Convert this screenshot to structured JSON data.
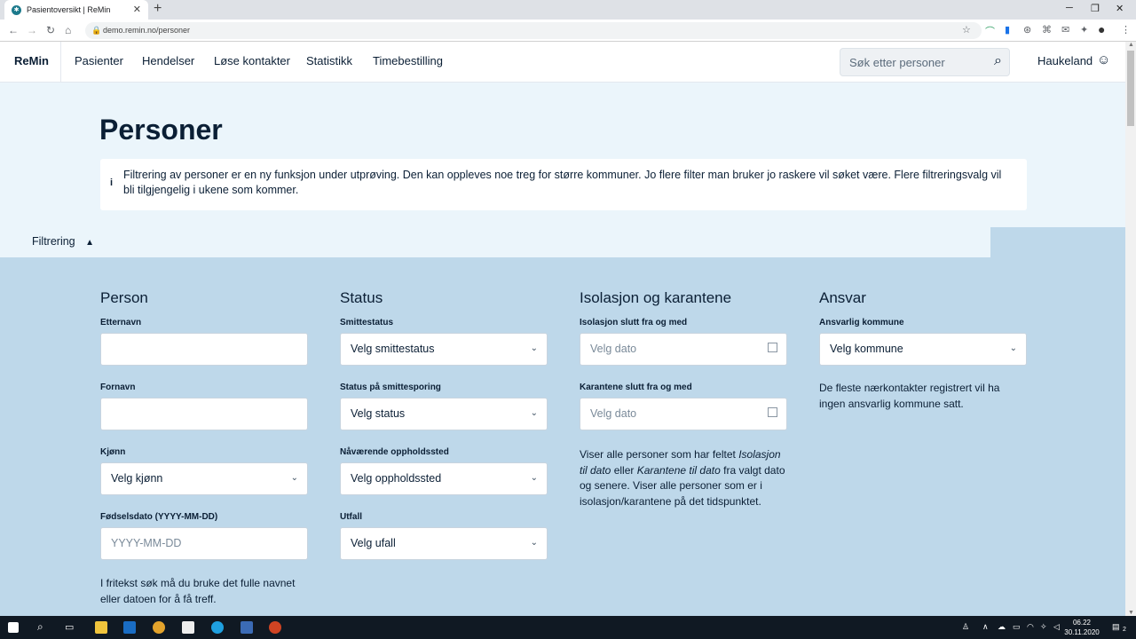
{
  "browser": {
    "tab_title": "Pasientoversikt | ReMin",
    "new_tab": "+",
    "url": "demo.remin.no/personer",
    "minimize": "─",
    "restore": "❐",
    "close": "✕"
  },
  "header": {
    "brand": "ReMin",
    "nav": [
      "Pasienter",
      "Hendelser",
      "Løse kontakter",
      "Statistikk",
      "Timebestilling"
    ],
    "search_placeholder": "Søk etter personer",
    "user": "Haukeland"
  },
  "page": {
    "title": "Personer",
    "info": "Filtrering av personer er en ny funksjon under utprøving. Den kan oppleves noe treg for større kommuner. Jo flere filter man bruker jo raskere vil søket være. Flere filtreringsvalg vil bli tilgjengelig i ukene som kommer.",
    "filter_toggle": "Filtrering"
  },
  "person": {
    "heading": "Person",
    "etternavn_label": "Etternavn",
    "fornavn_label": "Fornavn",
    "kjonn_label": "Kjønn",
    "kjonn_value": "Velg kjønn",
    "fodsel_label": "Fødselsdato (YYYY-MM-DD)",
    "fodsel_placeholder": "YYYY-MM-DD",
    "note": "I fritekst søk må du bruke det fulle navnet eller datoen for å få treff."
  },
  "status": {
    "heading": "Status",
    "smitte_label": "Smittestatus",
    "smitte_value": "Velg smittestatus",
    "sporing_label": "Status på smittesporing",
    "sporing_value": "Velg status",
    "opphold_label": "Nåværende oppholdssted",
    "opphold_value": "Velg oppholdssted",
    "utfall_label": "Utfall",
    "utfall_value": "Velg ufall"
  },
  "isolasjon": {
    "heading": "Isolasjon og karantene",
    "iso_label": "Isolasjon slutt fra og med",
    "iso_placeholder": "Velg dato",
    "kar_label": "Karantene slutt fra og med",
    "kar_placeholder": "Velg dato",
    "note_a": "Viser alle personer som har feltet ",
    "note_em1": "Isolasjon til dato",
    "note_b": " eller ",
    "note_em2": "Karantene til dato",
    "note_c": " fra valgt dato og senere. Viser alle personer som er i isolasjon/karantene på det tidspunktet."
  },
  "ansvar": {
    "heading": "Ansvar",
    "kommune_label": "Ansvarlig kommune",
    "kommune_value": "Velg kommune",
    "note": "De fleste nærkontakter registrert vil ha ingen ansvarlig kommune satt."
  },
  "taskbar": {
    "time": "06.22",
    "date": "30.11.2020",
    "notifications": "2"
  },
  "colors": {
    "accent_dark": "#0b1f35",
    "page_bg": "#ebf5fb",
    "filter_bg": "#bed8ea"
  }
}
